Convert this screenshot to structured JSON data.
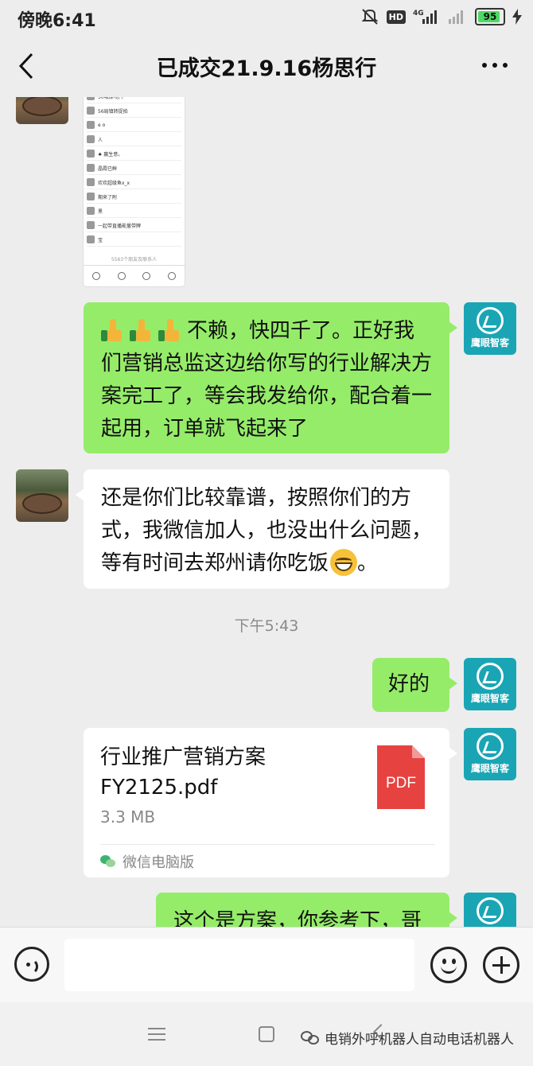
{
  "status_bar": {
    "time": "傍晚6:41",
    "network_label": "4G",
    "hd_label": "HD",
    "battery": "95",
    "icons": [
      "mute-icon",
      "hd-icon",
      "signal-icon",
      "signal-weak-icon",
      "battery-icon",
      "charging-icon"
    ]
  },
  "header": {
    "title": "已成交21.9.16杨思行"
  },
  "messages": [
    {
      "id": "m1",
      "sender": "contact",
      "type": "image",
      "thumbnail_rows": [
        "50哦球-忠平",
        "56局镇转捉拍",
        "e o",
        "人",
        "♠ 赢生意。",
        "晶霞已鲜",
        "欢欢超级鱼x_x",
        "期来了附",
        "黑",
        "一起带直播能量带牌",
        "宝"
      ],
      "thumbnail_footer": "5563个朋友及联系人"
    },
    {
      "id": "m2",
      "sender": "me",
      "type": "text",
      "emoji_prefix": [
        "thumbs-up-icon",
        "thumbs-up-icon",
        "thumbs-up-icon"
      ],
      "text": "不赖，快四千了。正好我们营销总监这边给你写的行业解决方案完工了，等会我发给你，配合着一起用，订单就飞起来了"
    },
    {
      "id": "m3",
      "sender": "contact",
      "type": "text",
      "text": "还是你们比较靠谱，按照你们的方式，我微信加人，也没出什么问题，等有时间去郑州请你吃饭",
      "text_suffix": "。",
      "emoji_inline": "grin-icon"
    },
    {
      "id": "t1",
      "type": "timestamp",
      "text": "下午5:43"
    },
    {
      "id": "m4",
      "sender": "me",
      "type": "text",
      "text": "好的"
    },
    {
      "id": "m5",
      "sender": "me",
      "type": "file",
      "file_name": "行业推广营销方案FY2125.pdf",
      "file_size": "3.3 MB",
      "file_icon_label": "PDF",
      "source": "微信电脑版"
    },
    {
      "id": "m6",
      "sender": "me",
      "type": "text",
      "text": "这个是方案，你参考下，哥"
    }
  ],
  "my_avatar": {
    "label": "鹰眼智客",
    "color": "#1aa5b5"
  },
  "input_bar": {
    "placeholder": "",
    "value": ""
  },
  "watermark": {
    "text": "电销外呼机器人自动电话机器人"
  },
  "colors": {
    "bubble_me": "#95ec69",
    "bubble_contact": "#ffffff",
    "background": "#ededed",
    "pdf_red": "#e64340"
  }
}
